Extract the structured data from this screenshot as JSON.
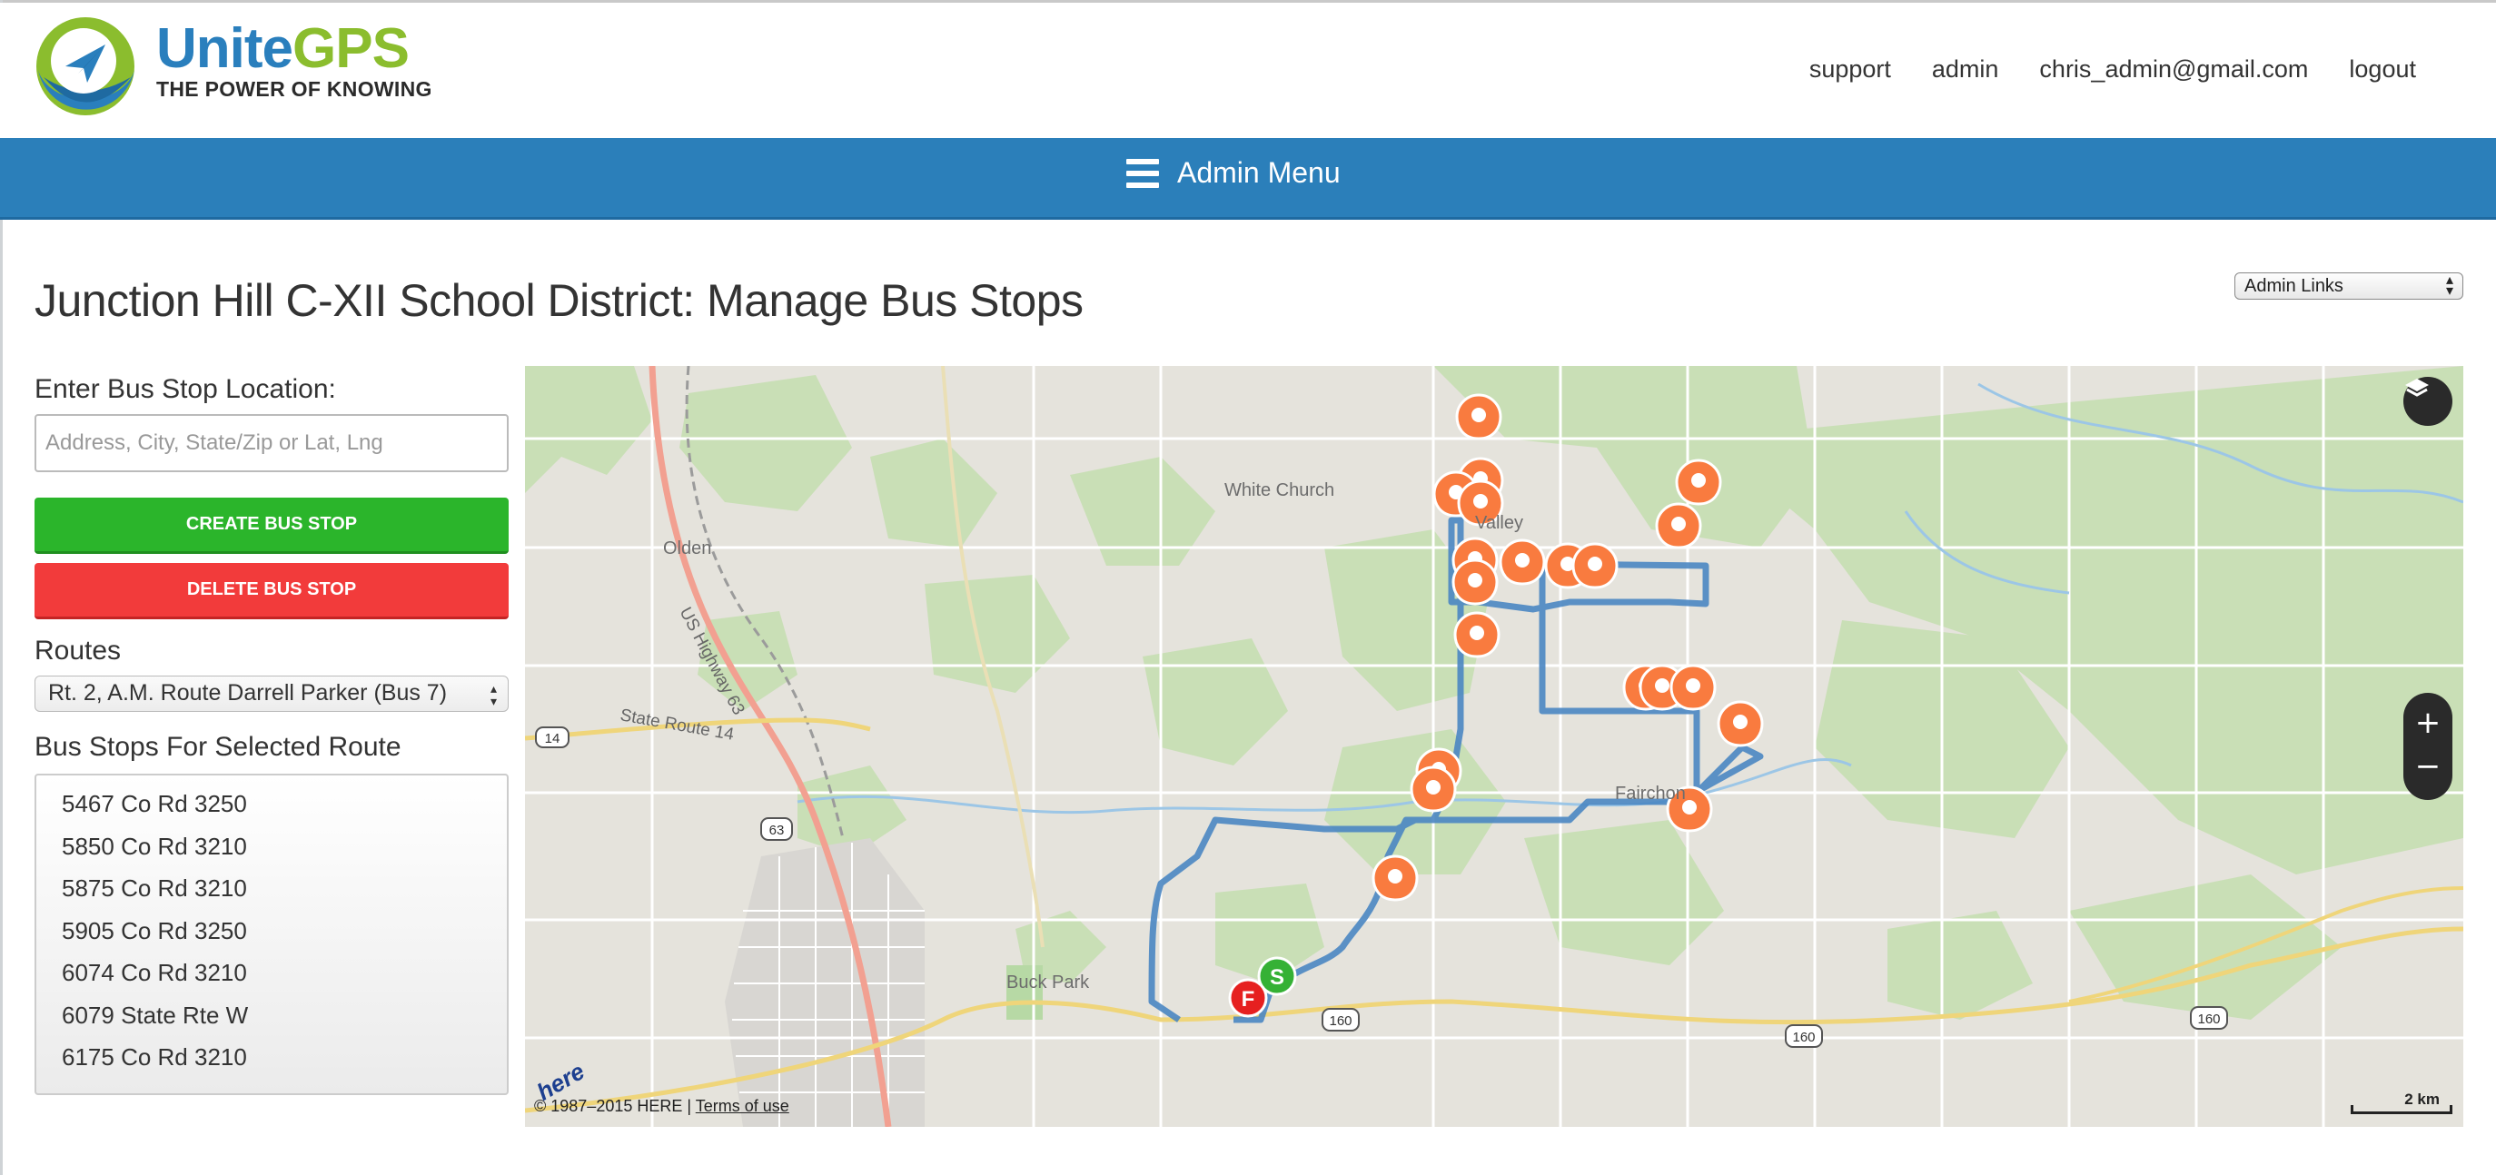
{
  "brand": {
    "name_part1": "Unite",
    "name_part2": "GPS",
    "tagline": "THE POWER OF KNOWING"
  },
  "topnav": {
    "support": "support",
    "admin": "admin",
    "email": "chris_admin@gmail.com",
    "logout": "logout"
  },
  "admin_menu": {
    "label": "Admin Menu"
  },
  "page": {
    "title": "Junction Hill C-XII School District: Manage Bus Stops",
    "admin_links": "Admin Links"
  },
  "form": {
    "location_label": "Enter Bus Stop Location:",
    "location_placeholder": "Address, City, State/Zip or Lat, Lng",
    "create_label": "CREATE BUS STOP",
    "delete_label": "DELETE BUS STOP",
    "routes_label": "Routes",
    "selected_route": "Rt. 2, A.M. Route Darrell Parker (Bus 7)",
    "stops_label": "Bus Stops For Selected Route",
    "stops": [
      "5467 Co Rd 3250",
      "5850 Co Rd 3210",
      "5875 Co Rd 3210",
      "5905 Co Rd 3250",
      "6074 Co Rd 3210",
      "6079 State Rte W",
      "6175 Co Rd 3210"
    ]
  },
  "map": {
    "places": [
      "White Church",
      "Olden",
      "Buck Park",
      "Fairchon",
      "Valley"
    ],
    "roads": [
      "US Highway 63",
      "State Route 14",
      "14",
      "63",
      "160"
    ],
    "start_marker": "S",
    "finish_marker": "F",
    "zoom_in": "+",
    "zoom_out": "−",
    "copyright": "© 1987–2015 HERE |",
    "terms": "Terms of use",
    "scale": "2 km",
    "provider": "here",
    "colors": {
      "route": "#4a86c2",
      "stop_marker": "#f97b3f",
      "start": "#35b135",
      "finish": "#e62020"
    }
  },
  "icons": {
    "menu": "hamburger-icon",
    "layers": "layers-icon",
    "stop": "map-pin-icon"
  }
}
